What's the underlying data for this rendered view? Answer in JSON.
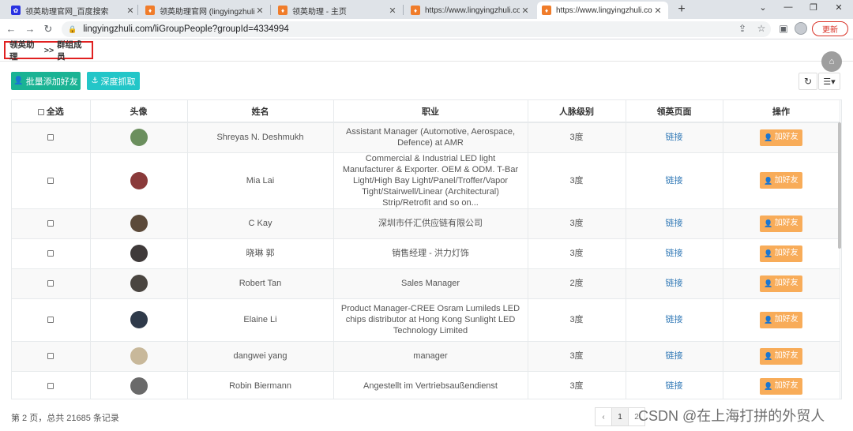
{
  "browser": {
    "tabs": [
      {
        "title": "领英助理官网_百度搜索",
        "icon_color": "#2932e1",
        "icon": "paw-icon"
      },
      {
        "title": "领英助理官网 (lingyingzhuli.com",
        "icon_color": "#f07c2a",
        "icon": "brand-icon"
      },
      {
        "title": "领英助理 - 主页",
        "icon_color": "#f07c2a",
        "icon": "brand-icon"
      },
      {
        "title": "https://www.lingyingzhuli.com",
        "icon_color": "#f07c2a",
        "icon": "brand-icon"
      },
      {
        "title": "https://www.lingyingzhuli.com",
        "icon_color": "#f07c2a",
        "icon": "brand-icon"
      }
    ],
    "url": "lingyingzhuli.com/liGroupPeople?groupId=4334994",
    "update_label": "更新"
  },
  "breadcrumb": {
    "root": "领英助理",
    "sep": ">>",
    "current": "群组成员"
  },
  "toolbar": {
    "add_friends_label": "批量添加好友",
    "deep_crawl_label": "深度抓取"
  },
  "table": {
    "headers": {
      "select_all": "全选",
      "avatar": "头像",
      "name": "姓名",
      "title": "职业",
      "degree": "人脉级别",
      "page": "领英页面",
      "action": "操作"
    },
    "rows": [
      {
        "name": "Shreyas N. Deshmukh",
        "title": "Assistant Manager (Automotive, Aerospace, Defence) at AMR",
        "degree": "3度",
        "link": "链接",
        "action": "加好友",
        "avatar_color": "#6b8f5e"
      },
      {
        "name": "Mia Lai",
        "title": "Commercial & Industrial LED light Manufacturer & Exporter. OEM & ODM. T-Bar Light/High Bay Light/Panel/Troffer/Vapor Tight/Stairwell/Linear (Architectural) Strip/Retrofit and so on...",
        "degree": "3度",
        "link": "链接",
        "action": "加好友",
        "avatar_color": "#8a3a3a"
      },
      {
        "name": "C Kay",
        "title": "深圳市仟汇供应链有限公司",
        "degree": "3度",
        "link": "链接",
        "action": "加好友",
        "avatar_color": "#5c4a3a"
      },
      {
        "name": "晓琳 郭",
        "title": "销售经理 - 洪力灯饰",
        "degree": "3度",
        "link": "链接",
        "action": "加好友",
        "avatar_color": "#3f3a3a"
      },
      {
        "name": "Robert Tan",
        "title": "Sales Manager",
        "degree": "2度",
        "link": "链接",
        "action": "加好友",
        "avatar_color": "#4a4540"
      },
      {
        "name": "Elaine Li",
        "title": "Product Manager-CREE Osram Lumileds LED chips distributor at Hong Kong Sunlight LED Technology Limited",
        "degree": "3度",
        "link": "链接",
        "action": "加好友",
        "avatar_color": "#2f3a4a"
      },
      {
        "name": "dangwei yang",
        "title": "manager",
        "degree": "3度",
        "link": "链接",
        "action": "加好友",
        "avatar_color": "#c8b89a"
      },
      {
        "name": "Robin Biermann",
        "title": "Angestellt im Vertriebsaußendienst",
        "degree": "3度",
        "link": "链接",
        "action": "加好友",
        "avatar_color": "#6a6a6a"
      }
    ]
  },
  "footer": {
    "page_info": "第 2 页，总共 21685 条记录",
    "pager": [
      "‹",
      "1",
      "2"
    ],
    "watermark": "CSDN @在上海打拼的外贸人"
  }
}
